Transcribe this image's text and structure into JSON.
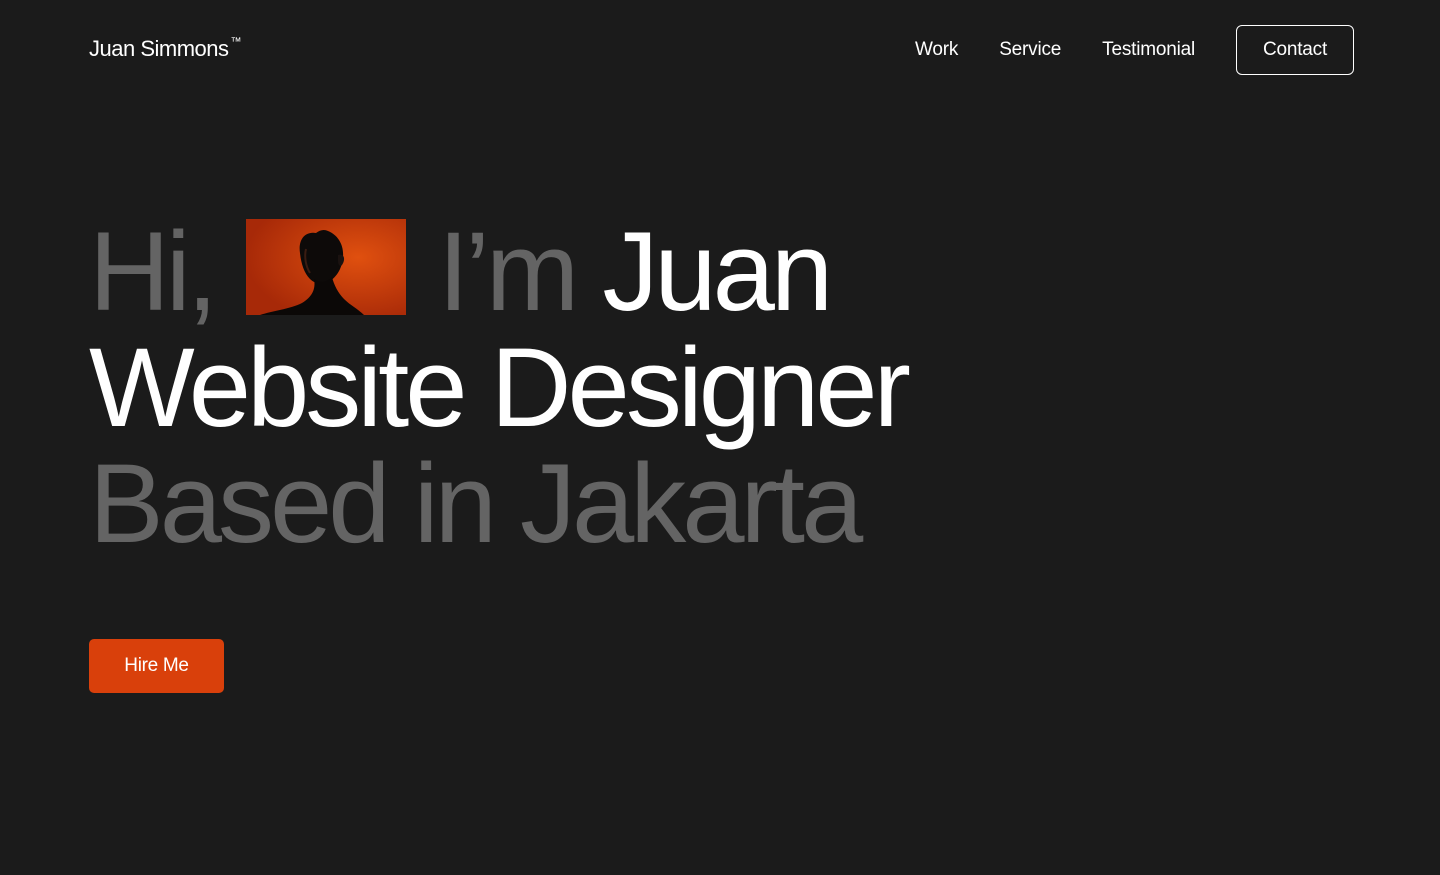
{
  "header": {
    "brand": "Juan Simmons",
    "trademark": "™",
    "nav": {
      "work": "Work",
      "service": "Service",
      "testimonial": "Testimonial"
    },
    "contact_label": "Contact"
  },
  "hero": {
    "line1": {
      "greeting": "Hi,",
      "im": "I’m",
      "name": "Juan"
    },
    "line2": "Website Designer",
    "line3": "Based in Jakarta",
    "portrait_icon": "portrait-photo"
  },
  "cta": {
    "hire_label": "Hire Me"
  },
  "colors": {
    "background": "#1b1b1b",
    "accent": "#d9400b",
    "muted_text": "#646464",
    "text": "#ffffff"
  }
}
